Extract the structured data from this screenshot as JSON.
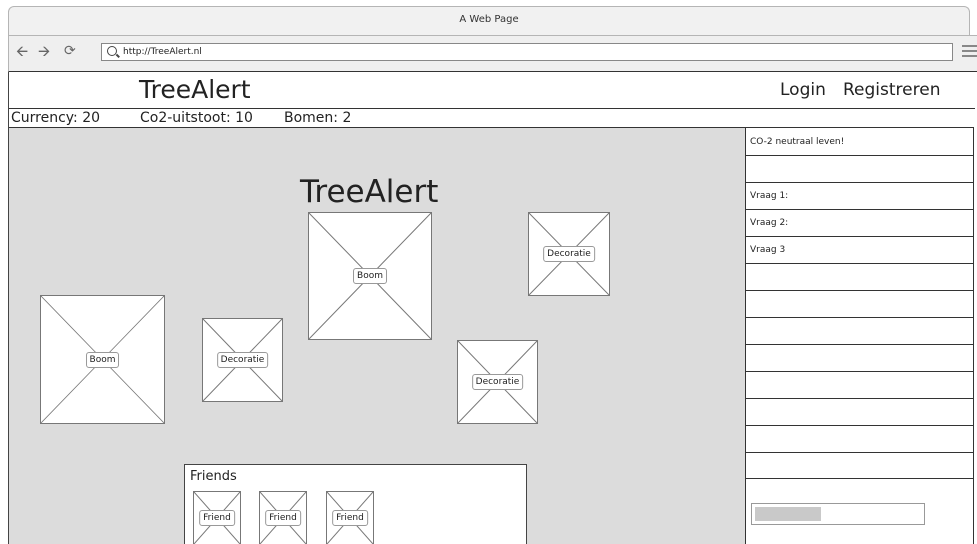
{
  "window": {
    "title": "A Web Page"
  },
  "browser": {
    "url": "http://TreeAlert.nl",
    "back_icon": "arrow-left-icon",
    "forward_icon": "arrow-right-icon",
    "reload_icon": "reload-icon"
  },
  "header": {
    "brand": "TreeAlert",
    "login_label": "Login",
    "register_label": "Registreren"
  },
  "stats": {
    "currency": "Currency: 20",
    "co2": "Co2-uitstoot: 10",
    "trees": "Bomen: 2"
  },
  "canvas": {
    "title": "TreeAlert",
    "items": [
      {
        "label": "Boom"
      },
      {
        "label": "Decoratie"
      },
      {
        "label": "Boom"
      },
      {
        "label": "Decoratie"
      },
      {
        "label": "Decoratie"
      }
    ]
  },
  "friends": {
    "title": "Friends",
    "items": [
      {
        "label": "Friend"
      },
      {
        "label": "Friend"
      },
      {
        "label": "Friend"
      }
    ]
  },
  "sidebar": {
    "headline": "CO-2 neutraal leven!",
    "questions": [
      {
        "label": "Vraag 1:"
      },
      {
        "label": "Vraag 2:"
      },
      {
        "label": "Vraag 3"
      }
    ],
    "progress_fraction": 0.4
  }
}
